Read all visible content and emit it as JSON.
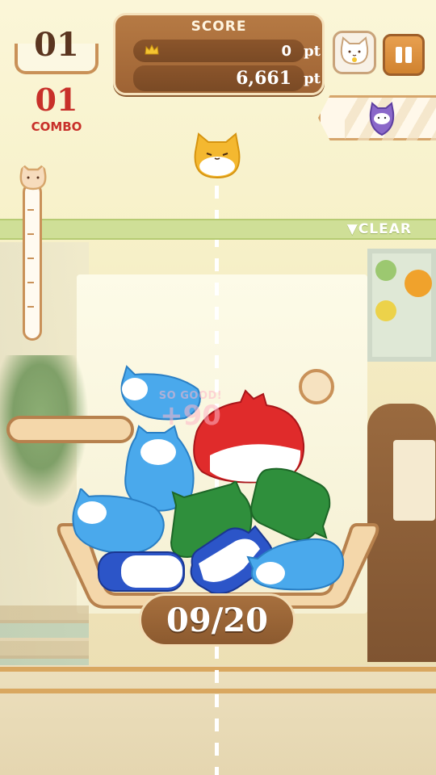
{
  "hud": {
    "drops": "01",
    "combo_count": "01",
    "combo_label": "COMBO"
  },
  "score": {
    "title": "SCORE",
    "best": "0",
    "current": "6,661",
    "unit": "pt"
  },
  "clear_line": {
    "label": "▼CLEAR"
  },
  "popup": {
    "label": "SO GOOD!",
    "value": "+90"
  },
  "progress": {
    "text": "09/20",
    "placed": 9,
    "goal": 20
  },
  "icons": {
    "crown": "crown-icon",
    "cat_menu": "cat-face-icon",
    "pause": "pause-icon",
    "next_piece": "purple-cat-icon"
  },
  "colors": {
    "blue_cat": "#4aa9ec",
    "red_cat": "#e02b2b",
    "green_cat": "#2f8f3c",
    "navy_cat": "#2c55c8",
    "yellow_cat": "#f4b830",
    "purple_cat": "#8a68c9"
  }
}
